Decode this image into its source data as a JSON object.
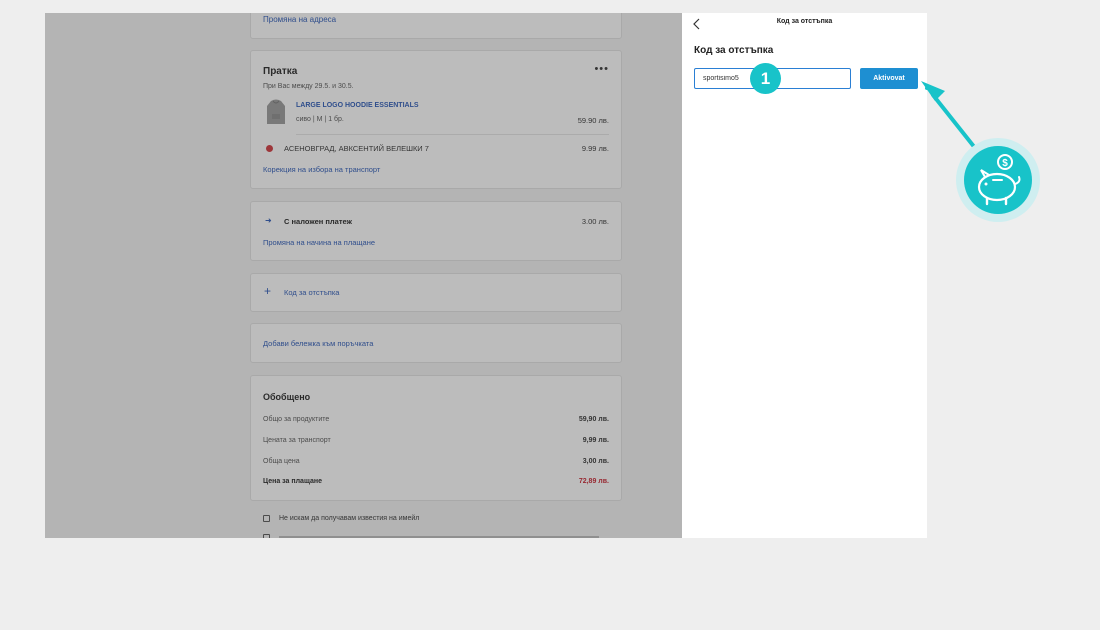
{
  "left": {
    "address_change": "Промяна на адреса",
    "shipment": {
      "title": "Пратка",
      "delivery_date": "При Вас между 29.5. и 30.5.",
      "more_icon": "more-dots-icon",
      "product": {
        "name": "LARGE LOGO HOODIE ESSENTIALS",
        "details": "сиво | M | 1 бр.",
        "price": "59.90 лв.",
        "image_icon": "hoodie-thumbnail"
      },
      "carrier": {
        "icon": "carrier-logo-icon",
        "address": "АСЕНОВГРАД, АВКСЕНТИЙ ВЕЛЕШКИ 7",
        "price": "9.99 лв."
      },
      "transport_link": "Корекция на избора на транспорт"
    },
    "payment": {
      "icon": "cash-icon",
      "method": "С наложен платеж",
      "price": "3.00 лв.",
      "change_link": "Промяна на начина на плащане"
    },
    "discount": {
      "icon": "plus-icon",
      "label": "Код за отстъпка"
    },
    "note": {
      "label": "Добави бележка към поръчката"
    },
    "summary": {
      "title": "Обобщено",
      "rows": [
        {
          "label": "Общо за продуктите",
          "value": "59,90 лв."
        },
        {
          "label": "Цената за транспорт",
          "value": "9,99 лв."
        },
        {
          "label": "Обща цена",
          "value": "3,00 лв."
        },
        {
          "label": "Цена за плащане",
          "value": "72,89 лв."
        }
      ]
    },
    "newsletter_checkbox": "Не искам да получавам известия на имейл"
  },
  "right_panel": {
    "back_icon": "chevron-left-icon",
    "header_title": "Код за отстъпка",
    "section_title": "Код за отстъпка",
    "code_input_value": "sportisimo5",
    "activate_button": "Aktivovat"
  },
  "annotation": {
    "step_number": "1",
    "badge_icon": "piggy-bank-icon",
    "accent_color": "#18c3c9"
  }
}
